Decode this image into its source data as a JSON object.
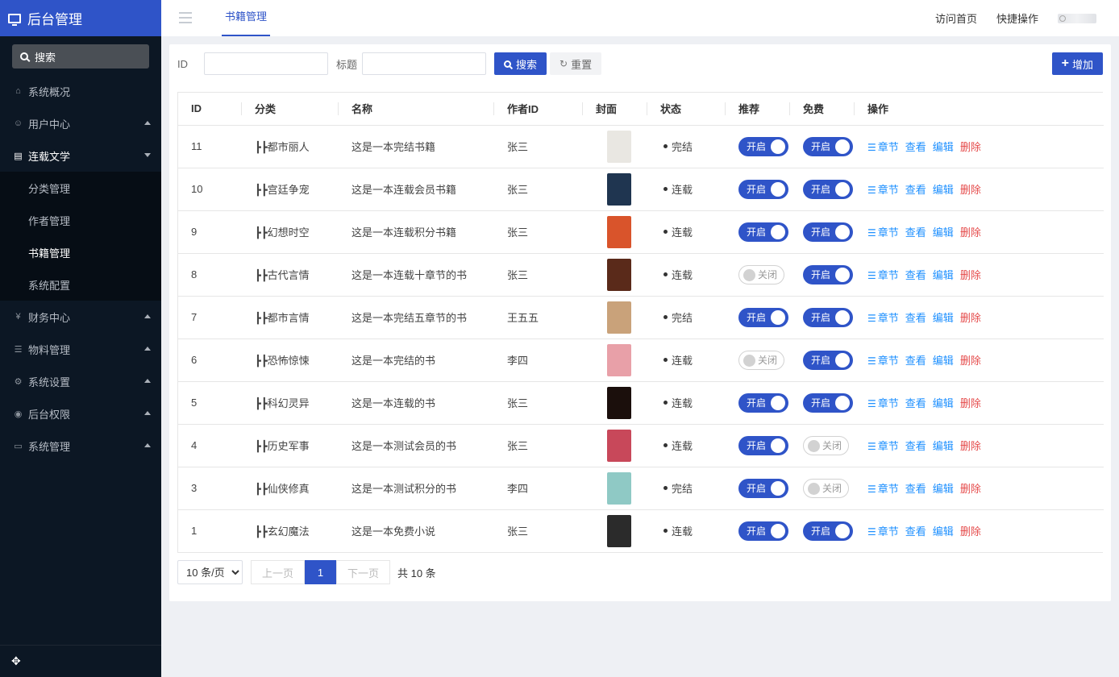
{
  "sidebar": {
    "title": "后台管理",
    "search_label": "搜索",
    "menu": [
      {
        "label": "系统概况",
        "icon": "home-icon"
      },
      {
        "label": "用户中心",
        "icon": "users-icon"
      },
      {
        "label": "连载文学",
        "icon": "document-icon"
      },
      {
        "label": "财务中心",
        "icon": "yen-icon"
      },
      {
        "label": "物料管理",
        "icon": "list-icon"
      },
      {
        "label": "系统设置",
        "icon": "gear-icon"
      },
      {
        "label": "后台权限",
        "icon": "user-circle-icon"
      },
      {
        "label": "系统管理",
        "icon": "monitor-icon"
      }
    ],
    "submenu": [
      {
        "label": "分类管理"
      },
      {
        "label": "作者管理"
      },
      {
        "label": "书籍管理"
      },
      {
        "label": "系统配置"
      }
    ],
    "bottom_icon": "move-icon"
  },
  "topbar": {
    "active_tab": "书籍管理",
    "visit_home": "访问首页",
    "quick_actions": "快捷操作"
  },
  "filter": {
    "id_label": "ID",
    "id_value": "",
    "title_label": "标题",
    "title_value": "",
    "search_button": "搜索",
    "reset_button": "重置",
    "add_button": "增加"
  },
  "table": {
    "headers": [
      "ID",
      "分类",
      "名称",
      "作者ID",
      "封面",
      "状态",
      "推荐",
      "免费",
      "操作"
    ],
    "switch_on": "开启",
    "switch_off": "关闭",
    "actions": {
      "chapter": "章节",
      "view": "查看",
      "edit": "编辑",
      "delete": "删除"
    },
    "rows": [
      {
        "id": "11",
        "category": "┣┣都市丽人",
        "name": "这是一本完结书籍",
        "author": "张三",
        "status": "完结",
        "recommend": true,
        "free": true,
        "cover": "#e9e7e2"
      },
      {
        "id": "10",
        "category": "┣┣宫廷争宠",
        "name": "这是一本连载会员书籍",
        "author": "张三",
        "status": "连载",
        "recommend": true,
        "free": true,
        "cover": "#1f3550"
      },
      {
        "id": "9",
        "category": "┣┣幻想时空",
        "name": "这是一本连载积分书籍",
        "author": "张三",
        "status": "连载",
        "recommend": true,
        "free": true,
        "cover": "#d9542b"
      },
      {
        "id": "8",
        "category": "┣┣古代言情",
        "name": "这是一本连载十章节的书",
        "author": "张三",
        "status": "连载",
        "recommend": false,
        "free": true,
        "cover": "#5a2a1a"
      },
      {
        "id": "7",
        "category": "┣┣都市言情",
        "name": "这是一本完结五章节的书",
        "author": "王五五",
        "status": "完结",
        "recommend": true,
        "free": true,
        "cover": "#c9a27a"
      },
      {
        "id": "6",
        "category": "┣┣恐怖惊悚",
        "name": "这是一本完结的书",
        "author": "李四",
        "status": "连载",
        "recommend": false,
        "free": true,
        "cover": "#e8a0a8"
      },
      {
        "id": "5",
        "category": "┣┣科幻灵异",
        "name": "这是一本连载的书",
        "author": "张三",
        "status": "连载",
        "recommend": true,
        "free": true,
        "cover": "#1b0f0c"
      },
      {
        "id": "4",
        "category": "┣┣历史军事",
        "name": "这是一本测试会员的书",
        "author": "张三",
        "status": "连载",
        "recommend": true,
        "free": false,
        "cover": "#c8485a"
      },
      {
        "id": "3",
        "category": "┣┣仙侠修真",
        "name": "这是一本测试积分的书",
        "author": "李四",
        "status": "完结",
        "recommend": true,
        "free": false,
        "cover": "#8fc9c5"
      },
      {
        "id": "1",
        "category": "┣┣玄幻魔法",
        "name": "这是一本免费小说",
        "author": "张三",
        "status": "连载",
        "recommend": true,
        "free": true,
        "cover": "#2b2b2b"
      }
    ]
  },
  "pager": {
    "page_size": "10 条/页",
    "prev": "上一页",
    "current": "1",
    "next": "下一页",
    "total": "共 10 条"
  },
  "colors": {
    "accent": "#2f54c8",
    "sidebar_bg": "#0c1724",
    "link": "#1e90ff",
    "danger": "#e54b4b"
  }
}
